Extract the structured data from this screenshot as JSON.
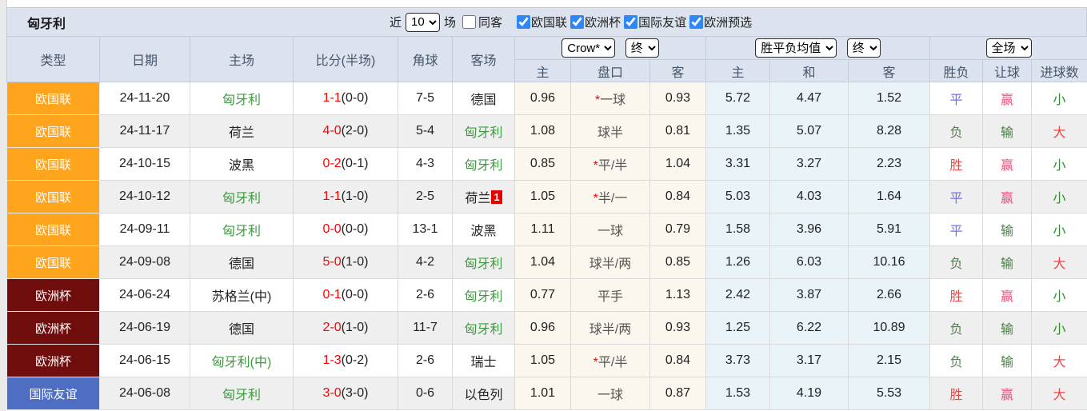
{
  "title": "匈牙利",
  "toolbar": {
    "recent_label": "近",
    "recent_value": "10",
    "matches_label": "场",
    "same_venue": {
      "label": "同客",
      "checked": false
    },
    "leagues": [
      {
        "label": "欧国联",
        "checked": true
      },
      {
        "label": "欧洲杯",
        "checked": true
      },
      {
        "label": "国际友谊",
        "checked": true
      },
      {
        "label": "欧洲预选",
        "checked": true
      }
    ]
  },
  "table": {
    "main_headers": [
      "类型",
      "日期",
      "主场",
      "比分(半场)",
      "角球",
      "客场"
    ],
    "selects": {
      "odds_company": "Crow*",
      "odds_time": "终",
      "avg_label": "胜平负均值",
      "avg_time": "终",
      "scope": "全场"
    },
    "sub_headers": [
      "主",
      "盘口",
      "客",
      "主",
      "和",
      "客",
      "胜负",
      "让球",
      "进球数"
    ],
    "rows": [
      {
        "league": "欧国联",
        "date": "24-11-20",
        "home": "匈牙利",
        "home_focus": true,
        "score_ft": "1-1",
        "score_ht": "(0-0)",
        "corners": "7-5",
        "away": "德国",
        "away_focus": false,
        "away_badge": "",
        "odds_home": "0.96",
        "handicap_star": "*",
        "handicap": "一球",
        "odds_away": "0.93",
        "avg_win": "5.72",
        "avg_draw": "4.47",
        "avg_lose": "1.52",
        "result": "平",
        "handicap_result": "赢",
        "goals": "小"
      },
      {
        "league": "欧国联",
        "date": "24-11-17",
        "home": "荷兰",
        "home_focus": false,
        "score_ft": "4-0",
        "score_ht": "(2-0)",
        "corners": "5-4",
        "away": "匈牙利",
        "away_focus": true,
        "away_badge": "",
        "odds_home": "1.08",
        "handicap_star": "",
        "handicap": "球半",
        "odds_away": "0.81",
        "avg_win": "1.35",
        "avg_draw": "5.07",
        "avg_lose": "8.28",
        "result": "负",
        "handicap_result": "输",
        "goals": "大"
      },
      {
        "league": "欧国联",
        "date": "24-10-15",
        "home": "波黑",
        "home_focus": false,
        "score_ft": "0-2",
        "score_ht": "(0-1)",
        "corners": "4-3",
        "away": "匈牙利",
        "away_focus": true,
        "away_badge": "",
        "odds_home": "0.85",
        "handicap_star": "*",
        "handicap": "平/半",
        "odds_away": "1.04",
        "avg_win": "3.31",
        "avg_draw": "3.27",
        "avg_lose": "2.23",
        "result": "胜",
        "handicap_result": "赢",
        "goals": "小"
      },
      {
        "league": "欧国联",
        "date": "24-10-12",
        "home": "匈牙利",
        "home_focus": true,
        "score_ft": "1-1",
        "score_ht": "(1-0)",
        "corners": "2-5",
        "away": "荷兰",
        "away_focus": false,
        "away_badge": "1",
        "odds_home": "1.05",
        "handicap_star": "*",
        "handicap": "半/一",
        "odds_away": "0.84",
        "avg_win": "5.03",
        "avg_draw": "4.03",
        "avg_lose": "1.64",
        "result": "平",
        "handicap_result": "赢",
        "goals": "小"
      },
      {
        "league": "欧国联",
        "date": "24-09-11",
        "home": "匈牙利",
        "home_focus": true,
        "score_ft": "0-0",
        "score_ht": "(0-0)",
        "corners": "13-1",
        "away": "波黑",
        "away_focus": false,
        "away_badge": "",
        "odds_home": "1.11",
        "handicap_star": "",
        "handicap": "一球",
        "odds_away": "0.79",
        "avg_win": "1.58",
        "avg_draw": "3.96",
        "avg_lose": "5.91",
        "result": "平",
        "handicap_result": "输",
        "goals": "小"
      },
      {
        "league": "欧国联",
        "date": "24-09-08",
        "home": "德国",
        "home_focus": false,
        "score_ft": "5-0",
        "score_ht": "(1-0)",
        "corners": "4-2",
        "away": "匈牙利",
        "away_focus": true,
        "away_badge": "",
        "odds_home": "1.04",
        "handicap_star": "",
        "handicap": "球半/两",
        "odds_away": "0.85",
        "avg_win": "1.26",
        "avg_draw": "6.03",
        "avg_lose": "10.16",
        "result": "负",
        "handicap_result": "输",
        "goals": "大"
      },
      {
        "league": "欧洲杯",
        "date": "24-06-24",
        "home": "苏格兰(中)",
        "home_focus": false,
        "score_ft": "0-1",
        "score_ht": "(0-0)",
        "corners": "2-6",
        "away": "匈牙利",
        "away_focus": true,
        "away_badge": "",
        "odds_home": "0.77",
        "handicap_star": "",
        "handicap": "平手",
        "odds_away": "1.13",
        "avg_win": "2.42",
        "avg_draw": "3.87",
        "avg_lose": "2.66",
        "result": "胜",
        "handicap_result": "赢",
        "goals": "小"
      },
      {
        "league": "欧洲杯",
        "date": "24-06-19",
        "home": "德国",
        "home_focus": false,
        "score_ft": "2-0",
        "score_ht": "(1-0)",
        "corners": "11-7",
        "away": "匈牙利",
        "away_focus": true,
        "away_badge": "",
        "odds_home": "0.96",
        "handicap_star": "",
        "handicap": "球半/两",
        "odds_away": "0.93",
        "avg_win": "1.25",
        "avg_draw": "6.22",
        "avg_lose": "10.89",
        "result": "负",
        "handicap_result": "输",
        "goals": "小"
      },
      {
        "league": "欧洲杯",
        "date": "24-06-15",
        "home": "匈牙利(中)",
        "home_focus": true,
        "score_ft": "1-3",
        "score_ht": "(0-2)",
        "corners": "2-6",
        "away": "瑞士",
        "away_focus": false,
        "away_badge": "",
        "odds_home": "1.05",
        "handicap_star": "*",
        "handicap": "平/半",
        "odds_away": "0.84",
        "avg_win": "3.73",
        "avg_draw": "3.17",
        "avg_lose": "2.15",
        "result": "负",
        "handicap_result": "输",
        "goals": "大"
      },
      {
        "league": "国际友谊",
        "date": "24-06-08",
        "home": "匈牙利",
        "home_focus": true,
        "score_ft": "3-0",
        "score_ht": "(3-0)",
        "corners": "0-6",
        "away": "以色列",
        "away_focus": false,
        "away_badge": "",
        "odds_home": "1.01",
        "handicap_star": "",
        "handicap": "一球",
        "odds_away": "0.87",
        "avg_win": "1.53",
        "avg_draw": "4.19",
        "avg_lose": "5.53",
        "result": "胜",
        "handicap_result": "赢",
        "goals": "大"
      }
    ]
  },
  "colors": {
    "header-bg": "#dce3ee",
    "odds-bg": "#fcf7ee",
    "mean-bg": "#e9f3f8",
    "league-nations": "#ffa41d",
    "league-euro": "#700e0e",
    "league-friendly": "#4d6ec3",
    "focus-team": "#3c9b3c",
    "score": "#fe0000",
    "win": "#e24b4b",
    "draw": "#6f6ff2",
    "lose": "#557f52",
    "cover": "#f0507e",
    "nocover": "#44813f",
    "over": "#f24343",
    "under": "#2c8f2c"
  }
}
